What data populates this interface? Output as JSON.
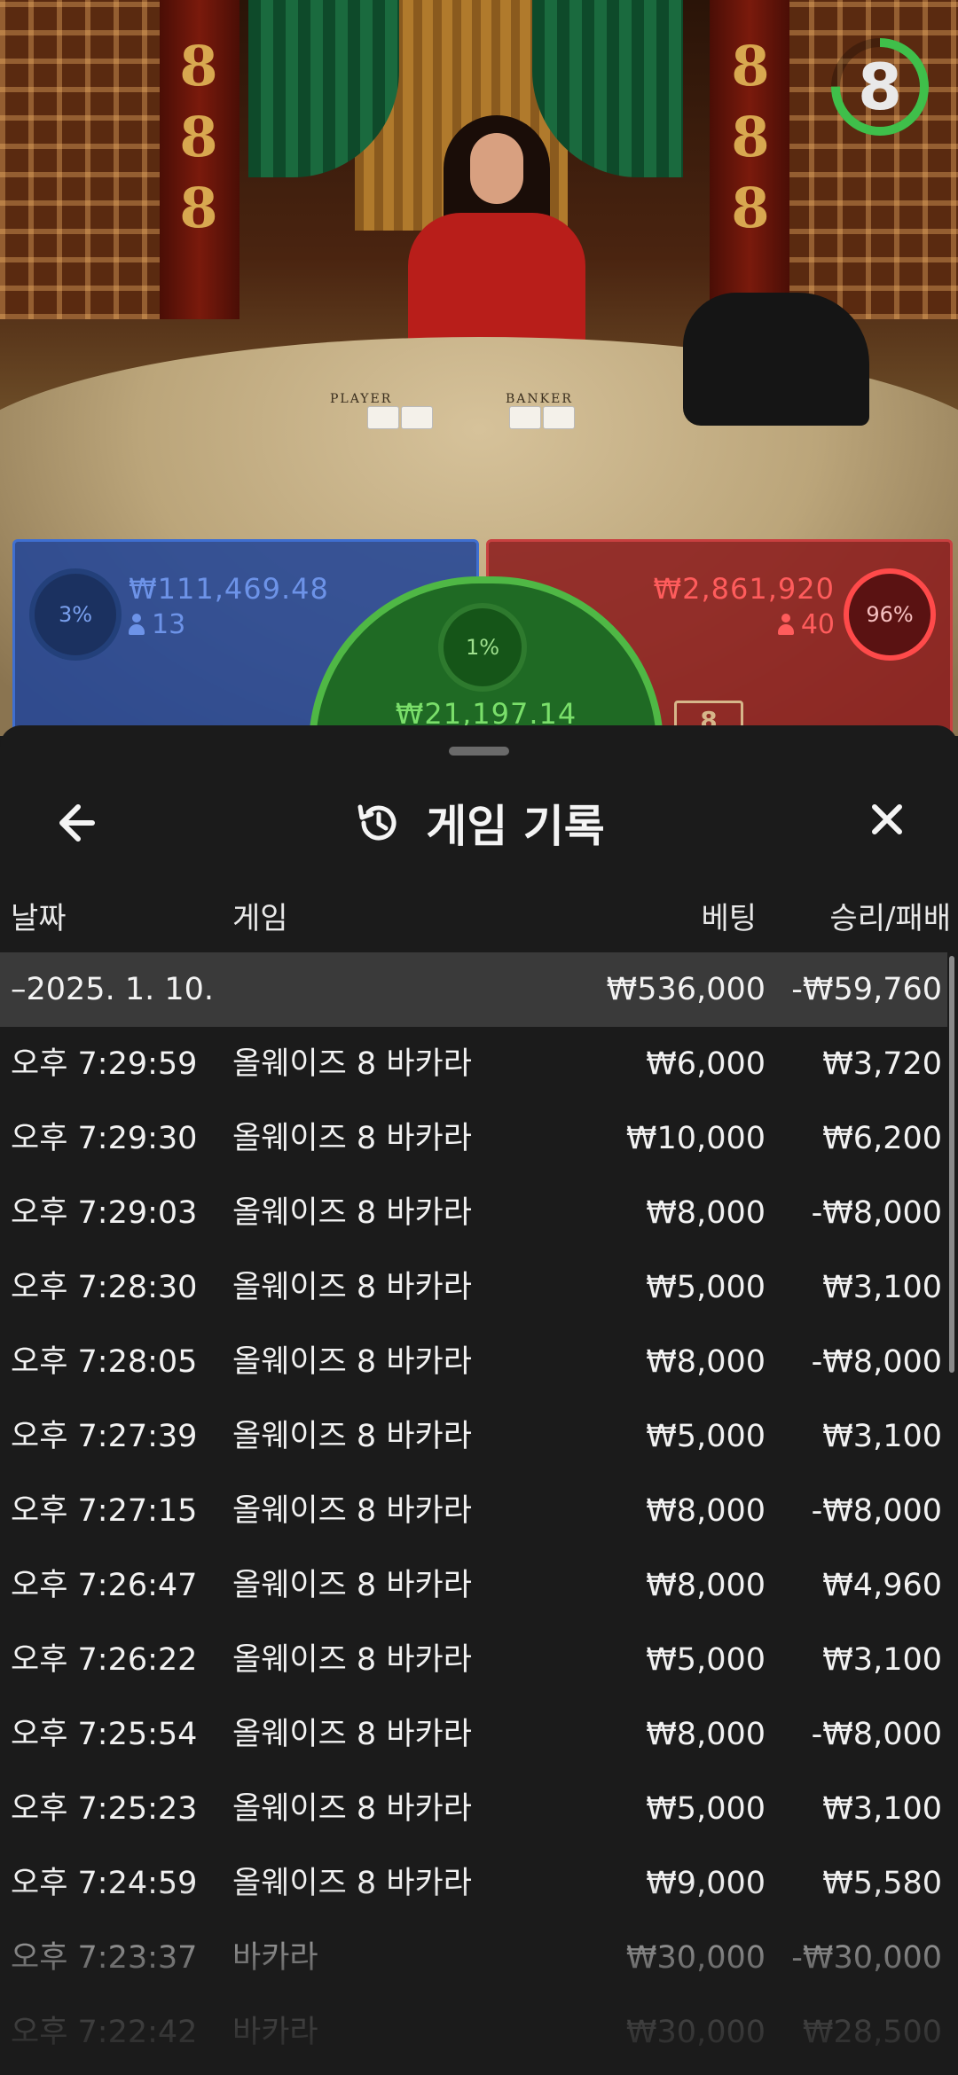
{
  "game_view": {
    "timer": "8",
    "timer_progress": 0.75,
    "timer_color": "#3fbf4a",
    "table_labels": {
      "player": "PLAYER",
      "banker": "BANKER"
    },
    "banker_tag": "8",
    "bets": {
      "player": {
        "percent": "3%",
        "amount": "₩111,469.48",
        "count": "13",
        "color": "#3f6fd0"
      },
      "tie": {
        "percent": "1%",
        "amount": "₩21,197.14",
        "color": "#4fb845"
      },
      "banker": {
        "percent": "96%",
        "amount": "₩2,861,920",
        "count": "40",
        "color": "#e03a3a"
      }
    }
  },
  "history": {
    "title": "게임 기록",
    "icons": {
      "back": "arrow-left-icon",
      "title": "history-icon",
      "close": "close-icon"
    },
    "columns": {
      "date": "날짜",
      "game": "게임",
      "bet": "베팅",
      "result": "승리/패배"
    },
    "summary": {
      "date": "–2025. 1. 10.",
      "bet": "₩536,000",
      "result": "-₩59,760"
    },
    "rows": [
      {
        "time": "오후 7:29:59",
        "game": "올웨이즈 8 바카라",
        "bet": "₩6,000",
        "result": "₩3,720"
      },
      {
        "time": "오후 7:29:30",
        "game": "올웨이즈 8 바카라",
        "bet": "₩10,000",
        "result": "₩6,200"
      },
      {
        "time": "오후 7:29:03",
        "game": "올웨이즈 8 바카라",
        "bet": "₩8,000",
        "result": "-₩8,000"
      },
      {
        "time": "오후 7:28:30",
        "game": "올웨이즈 8 바카라",
        "bet": "₩5,000",
        "result": "₩3,100"
      },
      {
        "time": "오후 7:28:05",
        "game": "올웨이즈 8 바카라",
        "bet": "₩8,000",
        "result": "-₩8,000"
      },
      {
        "time": "오후 7:27:39",
        "game": "올웨이즈 8 바카라",
        "bet": "₩5,000",
        "result": "₩3,100"
      },
      {
        "time": "오후 7:27:15",
        "game": "올웨이즈 8 바카라",
        "bet": "₩8,000",
        "result": "-₩8,000"
      },
      {
        "time": "오후 7:26:47",
        "game": "올웨이즈 8 바카라",
        "bet": "₩8,000",
        "result": "₩4,960"
      },
      {
        "time": "오후 7:26:22",
        "game": "올웨이즈 8 바카라",
        "bet": "₩5,000",
        "result": "₩3,100"
      },
      {
        "time": "오후 7:25:54",
        "game": "올웨이즈 8 바카라",
        "bet": "₩8,000",
        "result": "-₩8,000"
      },
      {
        "time": "오후 7:25:23",
        "game": "올웨이즈 8 바카라",
        "bet": "₩5,000",
        "result": "₩3,100"
      },
      {
        "time": "오후 7:24:59",
        "game": "올웨이즈 8 바카라",
        "bet": "₩9,000",
        "result": "₩5,580"
      },
      {
        "time": "오후 7:23:37",
        "game": "바카라",
        "bet": "₩30,000",
        "result": "-₩30,000"
      },
      {
        "time": "오후 7:22:42",
        "game": "바카라",
        "bet": "₩30,000",
        "result": "₩28,500"
      }
    ]
  }
}
